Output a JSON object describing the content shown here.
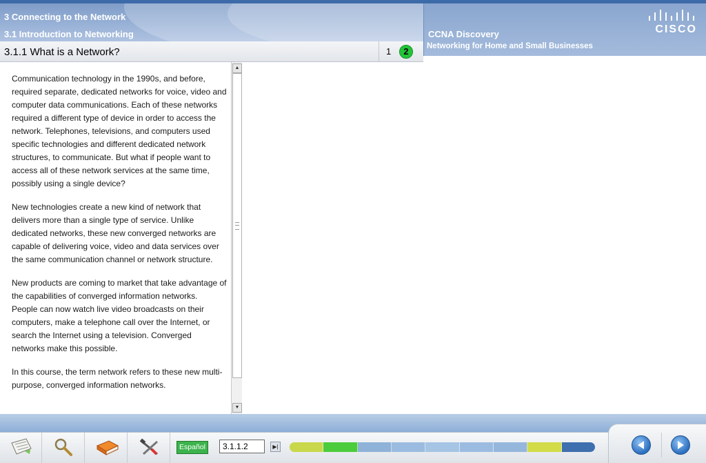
{
  "header": {
    "chapter": "3 Connecting to the Network",
    "section": "3.1 Introduction to Networking",
    "brand_title": "CCNA Discovery",
    "brand_subtitle": "Networking for Home and Small Businesses",
    "logo_text": "CISCO"
  },
  "page": {
    "title": "3.1.1 What is a Network?",
    "tabs": [
      {
        "label": "1",
        "active": false
      },
      {
        "label": "2",
        "active": true
      }
    ]
  },
  "content": {
    "paragraphs": [
      "Communication technology in the 1990s, and before,\nrequired separate, dedicated networks for voice, video and\ncomputer data communications. Each of these networks\nrequired a different type of device in order to access the\nnetwork. Telephones, televisions, and computers used\nspecific technologies and different dedicated network\nstructures, to communicate. But what if people want to\naccess all of these network services at the same time,\npossibly using a single device?",
      "New technologies create a new kind of network that\ndelivers more than a single type of service. Unlike\ndedicated networks, these new converged networks are\ncapable of delivering voice, video and data services over\nthe same communication channel or network structure.",
      "New products are coming to market that take advantage of\nthe capabilities of converged information networks.\nPeople can now watch live video broadcasts on their\ncomputers, make a telephone call over the Internet, or\nsearch the Internet using a television. Converged\nnetworks make this possible.",
      "In this course, the term network refers to these new multi-\npurpose, converged information networks."
    ]
  },
  "footer": {
    "tools": [
      "notes-icon",
      "search-icon",
      "glossary-book-icon",
      "tools-icon"
    ],
    "language_label": "Español",
    "page_number": "3.1.1.2",
    "progress_segments": [
      {
        "color": "#c8d84a"
      },
      {
        "color": "#4ccc3c"
      },
      {
        "color": "#8fb2d8"
      },
      {
        "color": "#9bbce0"
      },
      {
        "color": "#a6c4e4"
      },
      {
        "color": "#9bbce0"
      },
      {
        "color": "#95b7dc"
      },
      {
        "color": "#d2dc48"
      },
      {
        "color": "#3e6fae"
      }
    ],
    "nav": [
      "previous-page",
      "next-page"
    ]
  }
}
